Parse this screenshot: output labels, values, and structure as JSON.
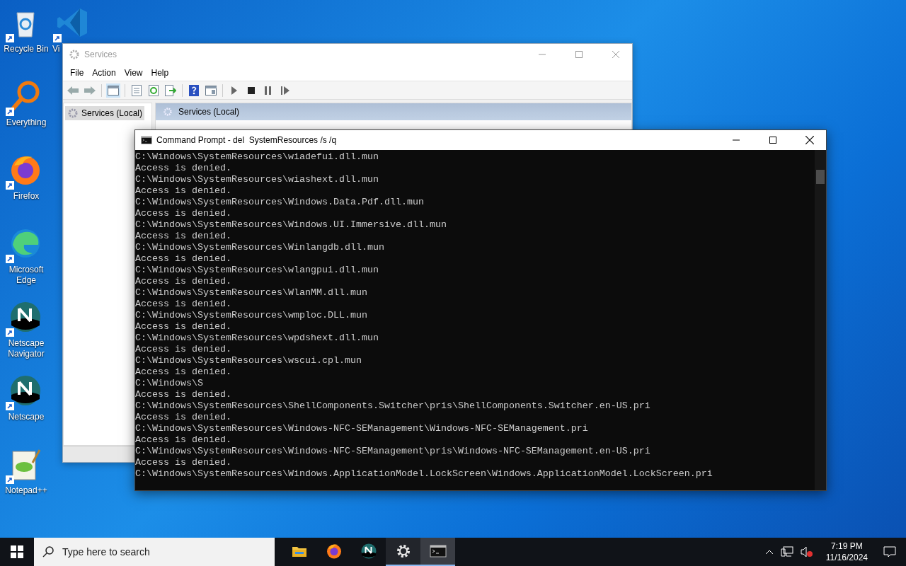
{
  "desktop": {
    "icons": [
      {
        "kind": "recycle",
        "label": "Recycle Bin"
      },
      {
        "kind": "search",
        "label": "Everything"
      },
      {
        "kind": "firefox",
        "label": "Firefox"
      },
      {
        "kind": "edge",
        "label": "Microsoft Edge"
      },
      {
        "kind": "netscape",
        "label": "Netscape Navigator"
      },
      {
        "kind": "netscape",
        "label": "Netscape"
      },
      {
        "kind": "notepad",
        "label": "Notepad++"
      }
    ],
    "hidden_icon": {
      "kind": "vscode",
      "label": "Vi"
    }
  },
  "services_window": {
    "title": "Services",
    "menu": [
      "File",
      "Action",
      "View",
      "Help"
    ],
    "tree": [
      {
        "label": "Services (Local)",
        "selected": true
      }
    ],
    "pane_title": "Services (Local)"
  },
  "console_window": {
    "title": "Command Prompt - del  SystemResources /s /q",
    "lines": [
      "C:\\Windows\\SystemResources\\wiadefui.dll.mun",
      "Access is denied.",
      "C:\\Windows\\SystemResources\\wiashext.dll.mun",
      "Access is denied.",
      "C:\\Windows\\SystemResources\\Windows.Data.Pdf.dll.mun",
      "Access is denied.",
      "C:\\Windows\\SystemResources\\Windows.UI.Immersive.dll.mun",
      "Access is denied.",
      "C:\\Windows\\SystemResources\\Winlangdb.dll.mun",
      "Access is denied.",
      "C:\\Windows\\SystemResources\\wlangpui.dll.mun",
      "Access is denied.",
      "C:\\Windows\\SystemResources\\WlanMM.dll.mun",
      "Access is denied.",
      "C:\\Windows\\SystemResources\\wmploc.DLL.mun",
      "Access is denied.",
      "C:\\Windows\\SystemResources\\wpdshext.dll.mun",
      "Access is denied.",
      "C:\\Windows\\SystemResources\\wscui.cpl.mun",
      "Access is denied.",
      "C:\\Windows\\S",
      "Access is denied.",
      "C:\\Windows\\SystemResources\\ShellComponents.Switcher\\pris\\ShellComponents.Switcher.en-US.pri",
      "Access is denied.",
      "C:\\Windows\\SystemResources\\Windows-NFC-SEManagement\\Windows-NFC-SEManagement.pri",
      "Access is denied.",
      "C:\\Windows\\SystemResources\\Windows-NFC-SEManagement\\pris\\Windows-NFC-SEManagement.en-US.pri",
      "Access is denied.",
      "C:\\Windows\\SystemResources\\Windows.ApplicationModel.LockScreen\\Windows.ApplicationModel.LockScreen.pri"
    ]
  },
  "taskbar": {
    "search": {
      "placeholder": "Type here to search"
    },
    "apps": [
      {
        "kind": "explorer",
        "running": false,
        "active": false
      },
      {
        "kind": "firefox",
        "running": false,
        "active": false
      },
      {
        "kind": "netscape",
        "running": false,
        "active": false
      },
      {
        "kind": "settings",
        "running": true,
        "active": false
      },
      {
        "kind": "terminal",
        "running": true,
        "active": true
      }
    ],
    "time": "7:19 PM",
    "date": "11/16/2024"
  }
}
